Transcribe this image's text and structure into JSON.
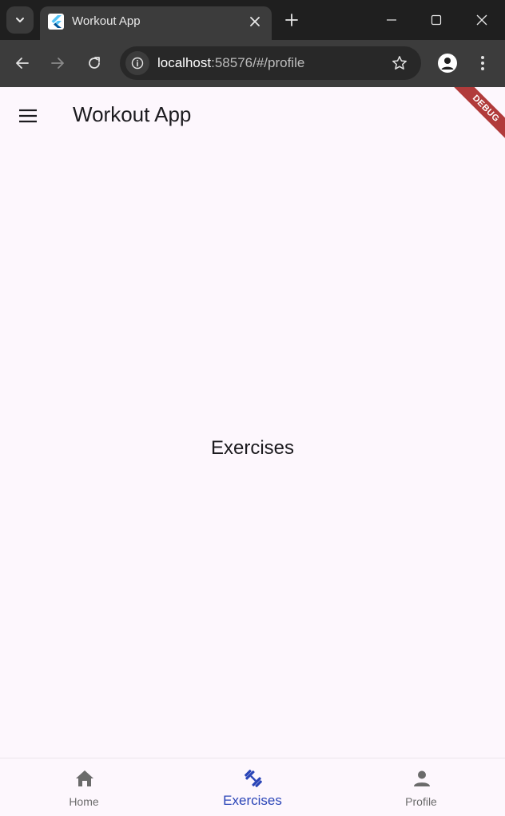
{
  "browser": {
    "tab_title": "Workout App",
    "url_host": "localhost",
    "url_path": ":58576/#/profile",
    "icons": {
      "tab_search": "chevron-down-icon",
      "favicon": "flutter-logo-icon",
      "tab_close": "close-icon",
      "new_tab": "plus-icon",
      "minimize": "minimize-icon",
      "maximize": "maximize-icon",
      "close_window": "close-icon",
      "back": "arrow-back-icon",
      "forward": "arrow-forward-icon",
      "reload": "reload-icon",
      "site_info": "info-icon",
      "bookmark": "star-icon",
      "profile": "account-icon",
      "menu": "more-vert-icon"
    }
  },
  "app": {
    "title": "Workout App",
    "debug_banner": "DEBUG",
    "body_text": "Exercises",
    "colors": {
      "background": "#fdf7fd",
      "active": "#2a45b7",
      "inactive": "#6b6b6b",
      "debug_ribbon": "#b13b3b"
    },
    "bottom_nav": [
      {
        "label": "Home",
        "icon": "home-icon",
        "active": false
      },
      {
        "label": "Exercises",
        "icon": "dumbbell-icon",
        "active": true
      },
      {
        "label": "Profile",
        "icon": "person-icon",
        "active": false
      }
    ]
  }
}
